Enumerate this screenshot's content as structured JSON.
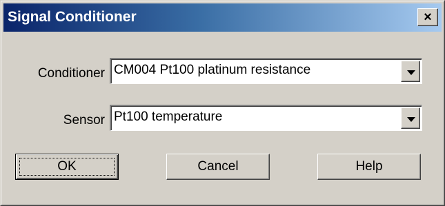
{
  "window": {
    "title": "Signal Conditioner",
    "close_glyph": "×"
  },
  "form": {
    "conditioner": {
      "label": "Conditioner",
      "value": "CM004 Pt100 platinum resistance"
    },
    "sensor": {
      "label": "Sensor",
      "value": "Pt100 temperature"
    }
  },
  "buttons": {
    "ok": "OK",
    "cancel": "Cancel",
    "help": "Help"
  },
  "colors": {
    "title_gradient_start": "#0a246a",
    "title_gradient_end": "#a6caf0",
    "face": "#d4d0c8"
  }
}
